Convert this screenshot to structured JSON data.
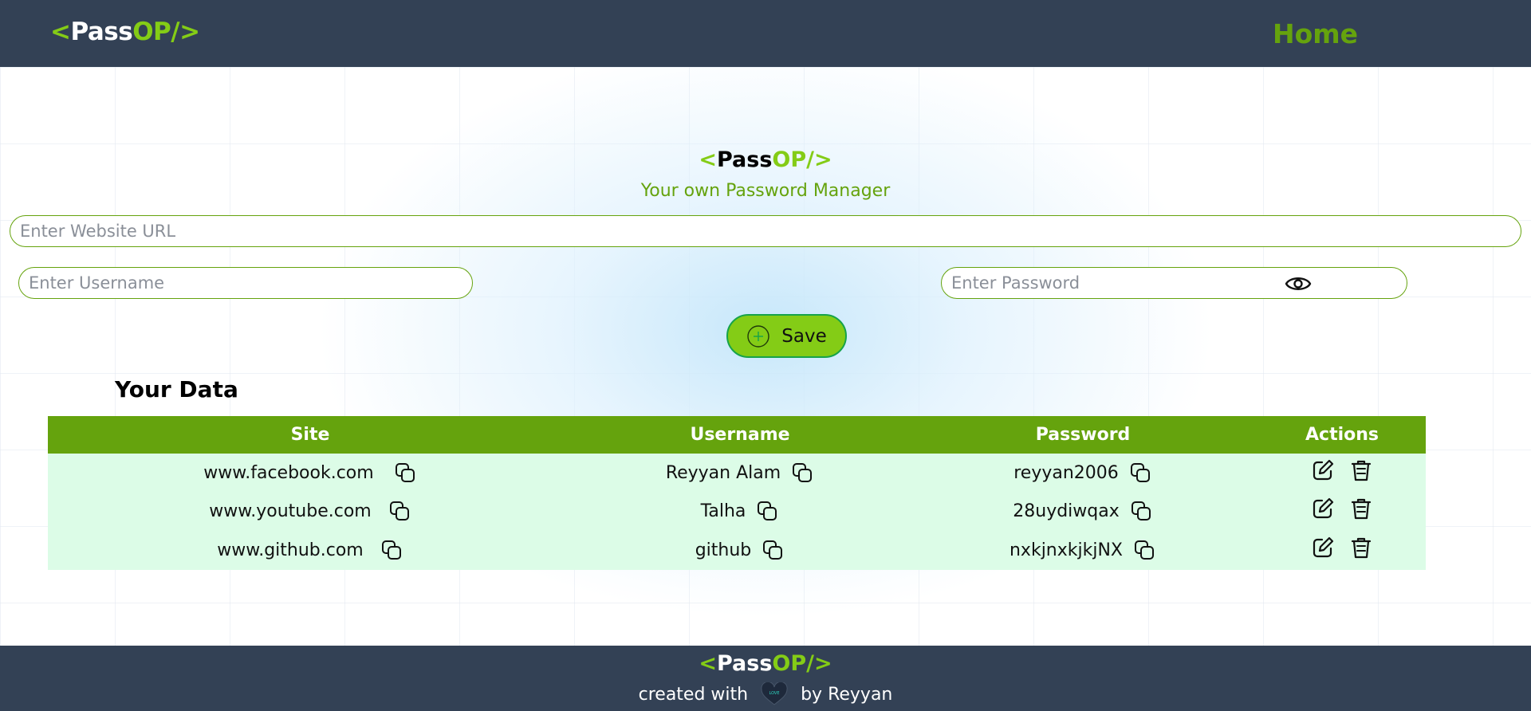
{
  "navbar": {
    "logo": {
      "open": "<",
      "pass": "Pass",
      "op": "OP/>"
    },
    "home_label": "Home"
  },
  "hero": {
    "logo": {
      "open": "<",
      "pass": "Pass",
      "op": "OP/>"
    },
    "tagline": "Your own Password Manager"
  },
  "form": {
    "url_placeholder": "Enter Website URL",
    "username_placeholder": "Enter Username",
    "password_placeholder": "Enter Password",
    "save_label": "Save"
  },
  "data_section": {
    "title": "Your Data",
    "columns": [
      "Site",
      "Username",
      "Password",
      "Actions"
    ],
    "rows": [
      {
        "site": "www.facebook.com",
        "username": "Reyyan Alam",
        "password": "reyyan2006"
      },
      {
        "site": "www.youtube.com",
        "username": "Talha",
        "password": "28uydiwqax"
      },
      {
        "site": "www.github.com",
        "username": "github",
        "password": "nxkjnxkjkjNX"
      }
    ]
  },
  "footer": {
    "logo": {
      "open": "<",
      "pass": "Pass",
      "op": "OP/>"
    },
    "created_with": "created with",
    "by": "by Reyyan",
    "heart_text": "LOVE"
  },
  "colors": {
    "nav_bg": "#334155",
    "accent_green": "#84cc16",
    "dark_green": "#65a30d",
    "row_bg": "#dcfce7",
    "button_border": "#16a34a"
  },
  "icons": [
    "eye-icon",
    "add-circle-icon",
    "copy-icon",
    "edit-icon",
    "trash-icon",
    "heart-icon"
  ]
}
